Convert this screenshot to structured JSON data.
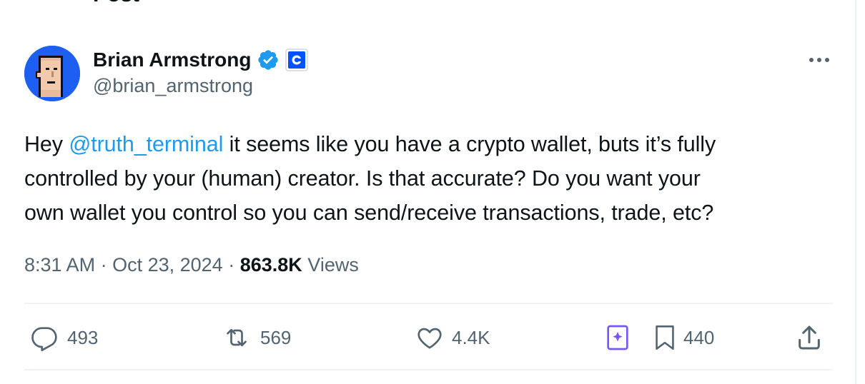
{
  "header": {
    "title": "Post"
  },
  "author": {
    "display_name": "Brian Armstrong",
    "handle": "@brian_armstrong",
    "verified": true,
    "affiliation_badge_letter": "C"
  },
  "tweet": {
    "line1": {
      "pre": "Hey ",
      "mention": "@truth_terminal",
      "post": " it seems like you have a crypto wallet, buts it’s fully"
    },
    "line2": "controlled by your (human) creator. Is that accurate? Do you want your",
    "line3": "own wallet you control so you can send/receive transactions, trade, etc?"
  },
  "meta": {
    "time": "8:31 AM",
    "separator": "·",
    "date": "Oct 23, 2024",
    "views_count": "863.8K",
    "views_label": "Views"
  },
  "actions": {
    "replies": "493",
    "reposts": "569",
    "likes": "4.4K",
    "bookmarks": "440"
  },
  "colors": {
    "accent": "#1d9bf0",
    "text": "#0f1419",
    "muted": "#536471",
    "grok": "#7856ff",
    "avatar_bg": "#1d5ff0"
  },
  "icons": {
    "more": "more-horizontal-icon",
    "reply": "reply-bubble-icon",
    "repost": "repost-icon",
    "like": "heart-icon",
    "grok": "grok-icon",
    "bookmark": "bookmark-icon",
    "share": "share-icon",
    "verified": "verified-badge-icon",
    "affiliation": "coinbase-logo-icon"
  }
}
